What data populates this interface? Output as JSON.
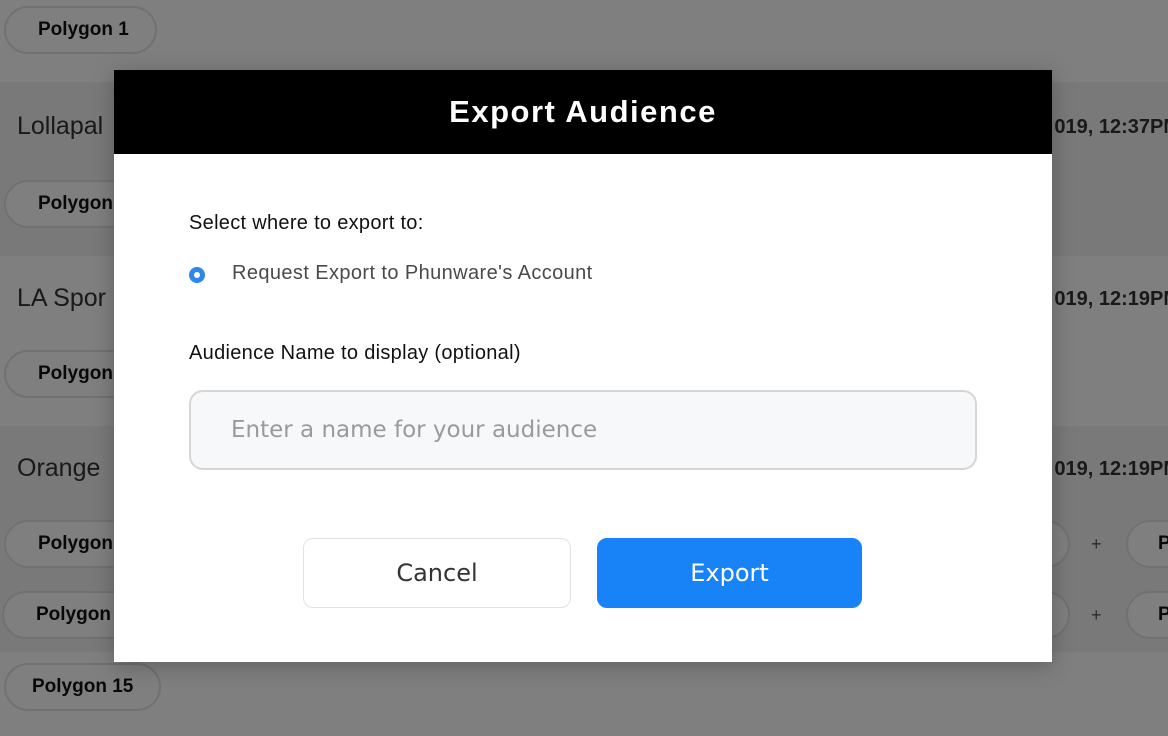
{
  "background": {
    "top_pill": "Polygon 1",
    "rows": [
      {
        "title": "Lollapal",
        "date": "019, 12:37PM",
        "pills": [
          "Polygon"
        ]
      },
      {
        "title": "LA Spor",
        "date": "019, 12:19PM",
        "pills": [
          "Polygon"
        ]
      },
      {
        "title": "Orange",
        "date": "019, 12:19PM",
        "pills": [
          "Polygon",
          "Polygon"
        ],
        "plus": "+",
        "right_pill": "P"
      }
    ],
    "bottom_pill": "Polygon 15"
  },
  "modal": {
    "title": "Export Audience",
    "destination_label": "Select where to export to:",
    "destination_option": "Request Export to Phunware's Account",
    "name_label": "Audience Name to display (optional)",
    "name_input": {
      "value": "",
      "placeholder": "Enter a name for your audience"
    },
    "cancel_label": "Cancel",
    "export_label": "Export"
  },
  "colors": {
    "header_bg": "#000000",
    "accent": "#1883f7",
    "radio": "#2f86ec"
  }
}
